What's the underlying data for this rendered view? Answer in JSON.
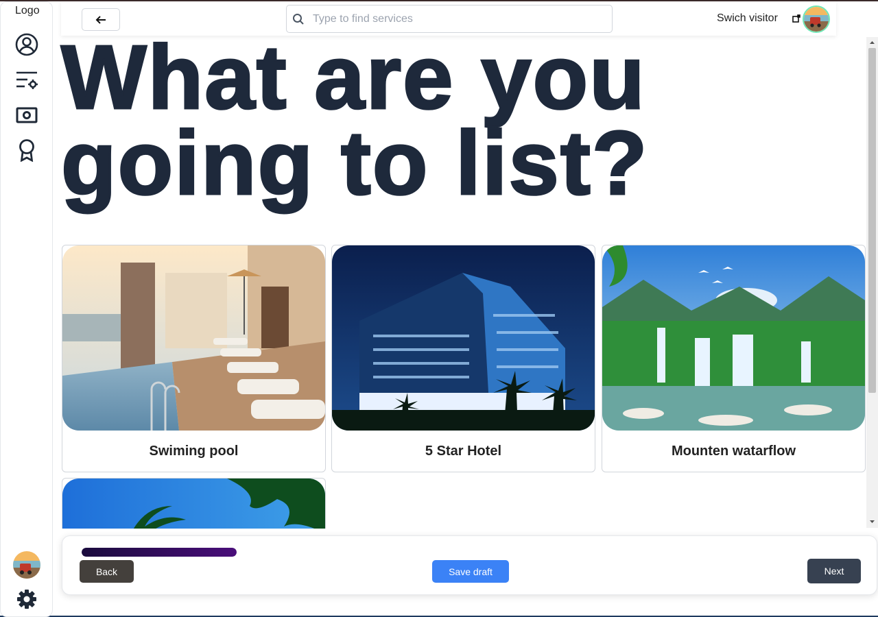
{
  "sidebar": {
    "logo": "Logo",
    "icons": [
      "user-circle-icon",
      "list-settings-icon",
      "banknote-icon",
      "award-icon",
      "gear-icon"
    ]
  },
  "header": {
    "search_placeholder": "Type to find services",
    "switch_label": "Swich visitor"
  },
  "main": {
    "title": "What are you going to list?",
    "cards": [
      {
        "label": "Swiming pool"
      },
      {
        "label": "5 Star Hotel"
      },
      {
        "label": "Mounten watarflow"
      },
      {
        "label": ""
      }
    ]
  },
  "footer": {
    "progress": 1.0,
    "back_label": "Back",
    "save_label": "Save draft",
    "next_label": "Next"
  },
  "colors": {
    "heading": "#1e293b",
    "save_button": "#3b82f6",
    "next_button": "#374151",
    "back_button": "#44403c",
    "progress_fill": "#3b0f6b"
  }
}
